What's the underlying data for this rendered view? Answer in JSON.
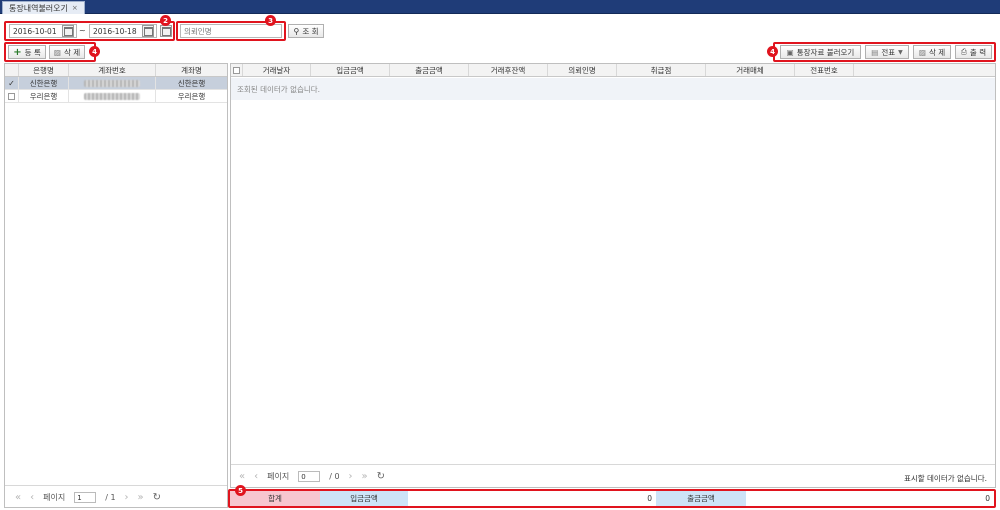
{
  "tab": {
    "title": "통장내역불러오기",
    "close": "×"
  },
  "search": {
    "date_from": "2016-10-01",
    "separator": "~",
    "date_to": "2016-10-18",
    "requester_placeholder": "의뢰인명",
    "search_label": "조 회"
  },
  "badges": {
    "b2": "2",
    "b3": "3",
    "b4a": "4",
    "b4b": "4",
    "b5": "5"
  },
  "left_toolbar": {
    "add_label": "등 록",
    "delete_label": "삭 제"
  },
  "right_toolbar": {
    "import_label": "통장자료 불러오기",
    "voucher_label": "전표",
    "delete_label": "삭 제",
    "print_label": "출 력"
  },
  "bank_table": {
    "headers": [
      "은행명",
      "계좌번호",
      "계좌명"
    ],
    "rows": [
      {
        "bank": "신한은행",
        "account_name": "신한은행",
        "checked": true
      },
      {
        "bank": "우리은행",
        "account_name": "우리은행",
        "checked": false
      }
    ]
  },
  "tx_table": {
    "headers": [
      "거래날자",
      "입금금액",
      "출금금액",
      "거래후잔액",
      "의뢰인명",
      "취급점",
      "거래매체",
      "전표번호"
    ],
    "empty_text": "조회된 데이터가 없습니다."
  },
  "left_pager": {
    "label": "페이지",
    "page": "1",
    "total": "/ 1"
  },
  "right_pager": {
    "label": "페이지",
    "page": "0",
    "total": "/ 0",
    "status": "표시할 데이터가 없습니다."
  },
  "summary": {
    "total_label": "합계",
    "deposit_label": "입금금액",
    "deposit_value": "0",
    "withdraw_label": "출금금액",
    "withdraw_value": "0"
  },
  "colors": {
    "accent_red": "#e0141e",
    "tab_bar": "#1f3c78",
    "selected_row": "#c6cfdc"
  }
}
